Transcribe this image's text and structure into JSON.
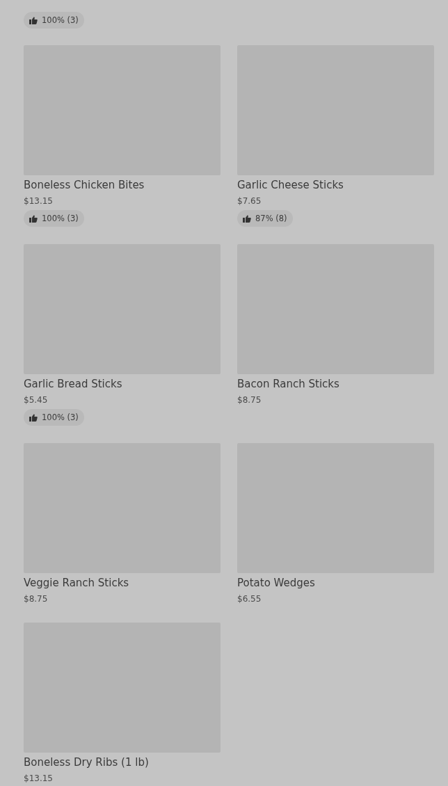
{
  "top_item": {
    "rating": "100% (3)"
  },
  "items": [
    {
      "name": "Boneless Chicken Bites",
      "price": "$13.15",
      "rating": "100% (3)"
    },
    {
      "name": "Garlic Cheese Sticks",
      "price": "$7.65",
      "rating": "87% (8)"
    },
    {
      "name": "Garlic Bread Sticks",
      "price": "$5.45",
      "rating": "100% (3)"
    },
    {
      "name": "Bacon Ranch Sticks",
      "price": "$8.75"
    },
    {
      "name": "Veggie Ranch Sticks",
      "price": "$8.75"
    },
    {
      "name": "Potato Wedges",
      "price": "$6.55"
    },
    {
      "name": "Boneless Dry Ribs (1 lb)",
      "price": "$13.15"
    }
  ]
}
